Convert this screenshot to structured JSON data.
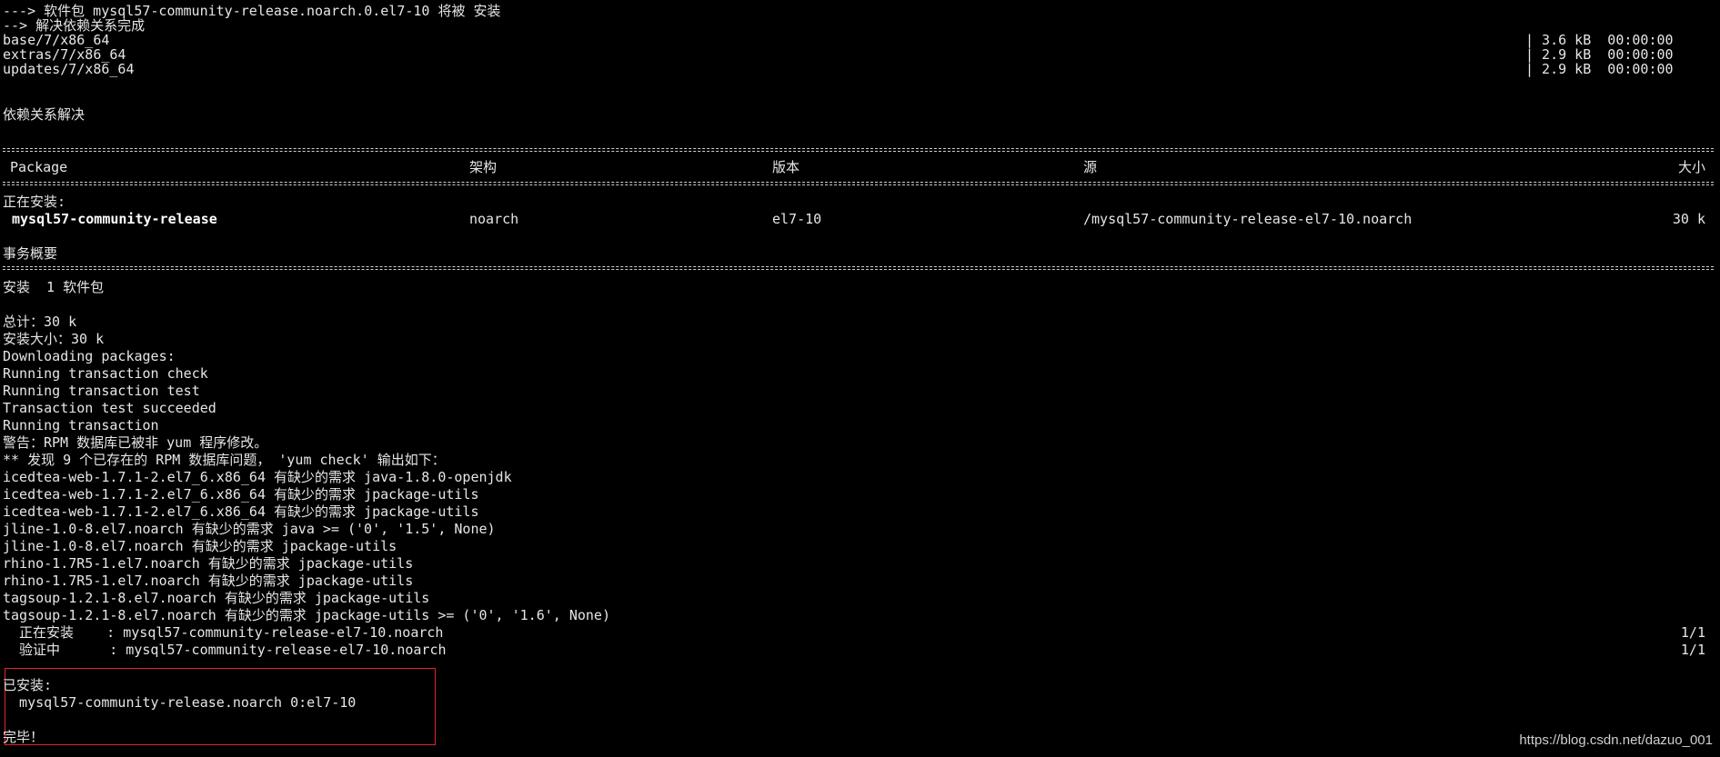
{
  "install_header": {
    "line1": "---> 软件包 mysql57-community-release.noarch.0.el7-10 将被 安装",
    "line2": "--> 解决依赖关系完成"
  },
  "repos": [
    {
      "name": "base/7/x86_64",
      "size": "| 3.6 kB  00:00:00"
    },
    {
      "name": "extras/7/x86_64",
      "size": "| 2.9 kB  00:00:00"
    },
    {
      "name": "updates/7/x86_64",
      "size": "| 2.9 kB  00:00:00"
    }
  ],
  "deps_resolved": "依赖关系解决",
  "table": {
    "headers": {
      "package": "Package",
      "arch": "架构",
      "version": "版本",
      "source": "源",
      "size": "大小"
    },
    "installing_label": "正在安装:",
    "row": {
      "package": "mysql57-community-release",
      "arch": "noarch",
      "version": "el7-10",
      "source": "/mysql57-community-release-el7-10.noarch",
      "size": "30 k"
    }
  },
  "summary": {
    "title": "事务概要",
    "install_count": "安装  1 软件包"
  },
  "log": [
    "总计：30 k",
    "安装大小：30 k",
    "Downloading packages:",
    "Running transaction check",
    "Running transaction test",
    "Transaction test succeeded",
    "Running transaction",
    "警告：RPM 数据库已被非 yum 程序修改。",
    "** 发现 9 个已存在的 RPM 数据库问题， 'yum check' 输出如下：",
    "icedtea-web-1.7.1-2.el7_6.x86_64 有缺少的需求 java-1.8.0-openjdk",
    "icedtea-web-1.7.1-2.el7_6.x86_64 有缺少的需求 jpackage-utils",
    "icedtea-web-1.7.1-2.el7_6.x86_64 有缺少的需求 jpackage-utils",
    "jline-1.0-8.el7.noarch 有缺少的需求 java >= ('0', '1.5', None)",
    "jline-1.0-8.el7.noarch 有缺少的需求 jpackage-utils",
    "rhino-1.7R5-1.el7.noarch 有缺少的需求 jpackage-utils",
    "rhino-1.7R5-1.el7.noarch 有缺少的需求 jpackage-utils",
    "tagsoup-1.2.1-8.el7.noarch 有缺少的需求 jpackage-utils",
    "tagsoup-1.2.1-8.el7.noarch 有缺少的需求 jpackage-utils >= ('0', '1.6', None)"
  ],
  "progress": [
    {
      "label": "  正在安装    : mysql57-community-release-el7-10.noarch",
      "count": "1/1"
    },
    {
      "label": "  验证中      : mysql57-community-release-el7-10.noarch",
      "count": "1/1"
    }
  ],
  "installed": {
    "label": "已安装:",
    "package": "  mysql57-community-release.noarch 0:el7-10"
  },
  "complete": "完毕！",
  "watermark": "https://blog.csdn.net/dazuo_001",
  "colors": {
    "background": "#000000",
    "text": "#e6e6e6",
    "highlight_border": "#e0262b"
  }
}
